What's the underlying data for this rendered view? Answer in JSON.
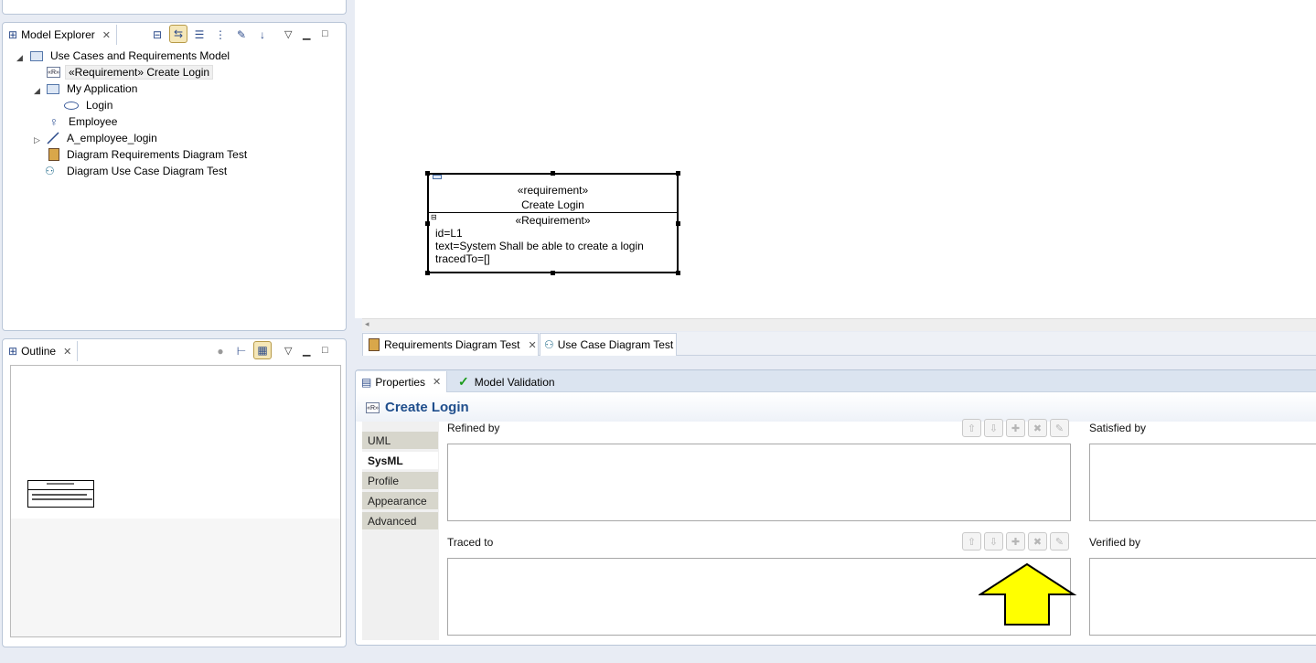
{
  "model_explorer": {
    "title": "Model Explorer",
    "tree": [
      {
        "label": "Use Cases and Requirements Model",
        "icon": "model-icon"
      },
      {
        "label": "«Requirement» Create Login",
        "icon": "requirement-icon",
        "selected": true
      },
      {
        "label": "My Application",
        "icon": "folder-icon"
      },
      {
        "label": "Login",
        "icon": "use-case-icon"
      },
      {
        "label": "Employee",
        "icon": "actor-icon"
      },
      {
        "label": "A_employee_login",
        "icon": "association-icon"
      },
      {
        "label": "Diagram Requirements Diagram Test",
        "icon": "requirements-diagram-icon"
      },
      {
        "label": "Diagram Use Case Diagram Test",
        "icon": "use-case-diagram-icon"
      }
    ]
  },
  "outline": {
    "title": "Outline"
  },
  "diagram": {
    "requirement_box": {
      "stereotype": "«requirement»",
      "name": "Create Login",
      "compartment_title": "«Requirement»",
      "id_line": "id=L1",
      "text_line": "text=System Shall be able to create a login",
      "traced_line": "tracedTo=[]"
    }
  },
  "editor_tabs": [
    {
      "label": "Requirements Diagram Test",
      "icon": "requirements-diagram-icon",
      "closable": true
    },
    {
      "label": "Use Case Diagram Test",
      "icon": "use-case-diagram-icon",
      "closable": false
    }
  ],
  "properties": {
    "tabs": [
      {
        "label": "Properties",
        "icon": "properties-icon"
      },
      {
        "label": "Model Validation",
        "icon": "check-icon"
      }
    ],
    "header_title": "Create Login",
    "side_tabs": [
      {
        "label": "UML",
        "active": false
      },
      {
        "label": "SysML",
        "active": true
      },
      {
        "label": "Profile",
        "active": false
      },
      {
        "label": "Appearance",
        "active": false
      },
      {
        "label": "Advanced",
        "active": false
      }
    ],
    "fields": {
      "refined_by": "Refined by",
      "satisfied_by": "Satisfied by",
      "traced_to": "Traced to",
      "verified_by": "Verified by"
    }
  },
  "annotation": {
    "arrow_color": "#ffff00"
  },
  "colors": {
    "accent": "#1f4e8c",
    "panel_border": "#b9c6d8",
    "side_tab": "#d7d6cc"
  }
}
